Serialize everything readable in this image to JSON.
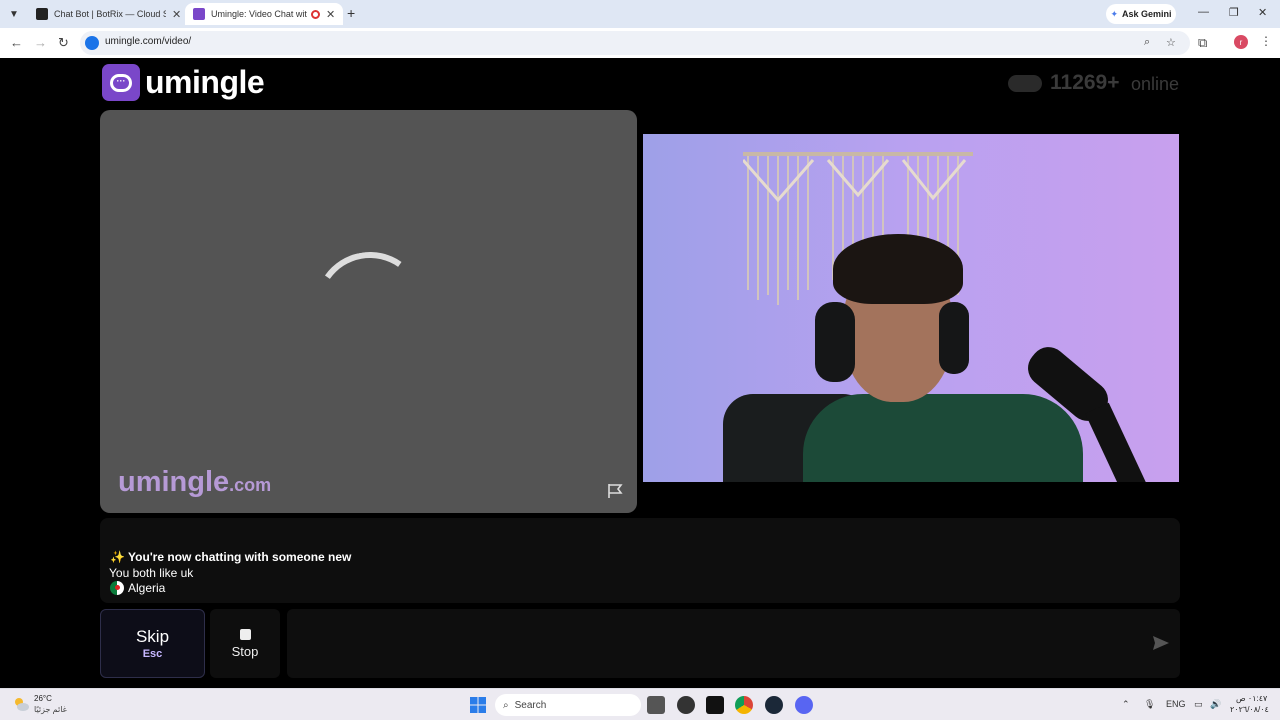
{
  "browser": {
    "tabs": [
      {
        "title": "Chat Bot | BotRix — Cloud Strea",
        "active": false
      },
      {
        "title": "Umingle: Video Chat with S",
        "active": true
      }
    ],
    "ask_gemini": "Ask Gemini",
    "url": "umingle.com/video/",
    "profile_initial": "r"
  },
  "site": {
    "logo_text": "umingle",
    "online_count": "11269+",
    "online_label": "online",
    "watermark_main": "umingle",
    "watermark_suffix": ".com"
  },
  "chat": {
    "new_partner": "✨ You're now chatting with someone new",
    "common_interest": "You both like uk",
    "country": "Algeria"
  },
  "controls": {
    "skip_label": "Skip",
    "skip_key": "Esc",
    "stop_label": "Stop",
    "message_placeholder": ""
  },
  "taskbar": {
    "weather_temp": "26°C",
    "weather_desc": "غائم جزئيًا",
    "search_label": "Search",
    "language": "ENG",
    "time": "٠١:٤٧ ص",
    "date": "٢٠٢٦/٠٨/٠٤"
  },
  "colors": {
    "brand_purple": "#7a47c9",
    "watermark": "#b69ad6",
    "skip_key": "#c6b7ff"
  }
}
